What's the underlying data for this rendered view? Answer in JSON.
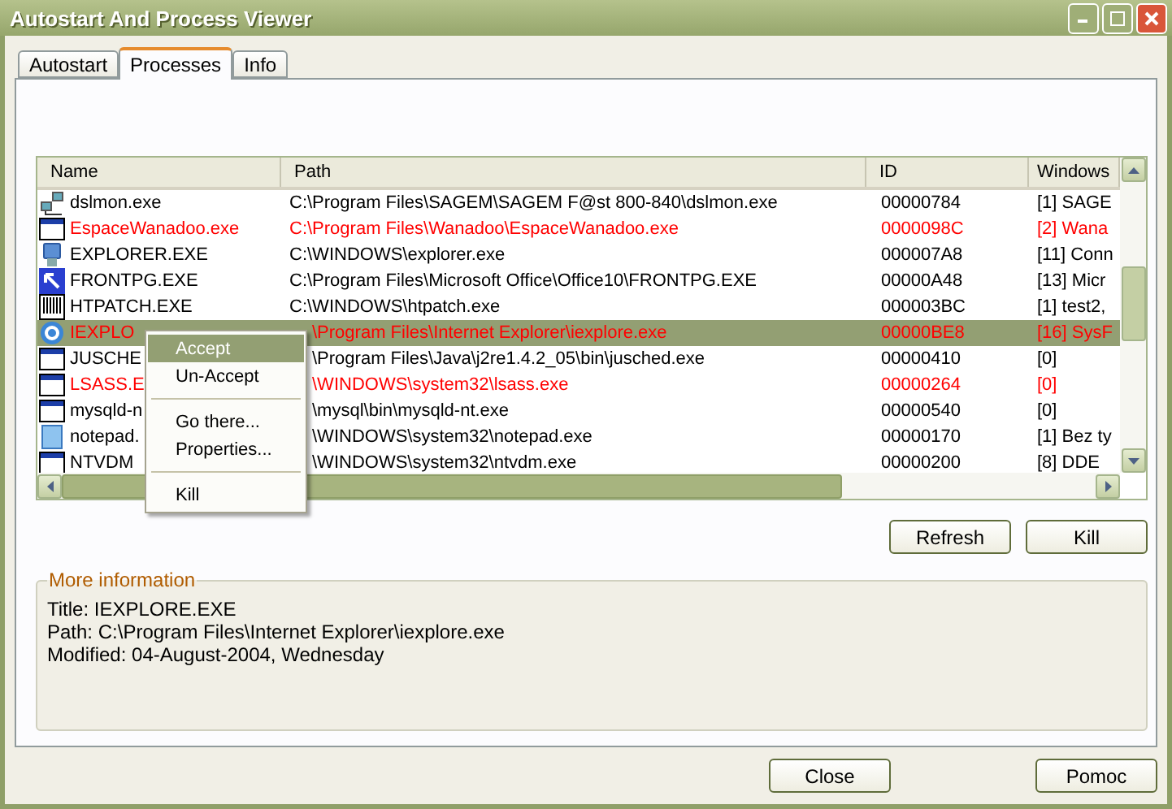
{
  "window": {
    "title": "Autostart And Process Viewer"
  },
  "tabs": [
    {
      "label": "Autostart",
      "selected": false
    },
    {
      "label": "Processes",
      "selected": true
    },
    {
      "label": "Info",
      "selected": false
    }
  ],
  "table": {
    "columns": [
      "Name",
      "Path",
      "ID",
      "Windows"
    ],
    "rows": [
      {
        "kind": "network",
        "name": "dslmon.exe",
        "path": "C:\\Program Files\\SAGEM\\SAGEM F@st 800-840\\dslmon.exe",
        "id": "00000784",
        "windows": "[1] SAGE",
        "accepted": true,
        "selected": false
      },
      {
        "kind": "window",
        "name": "EspaceWanadoo.exe",
        "path": "C:\\Program Files\\Wanadoo\\EspaceWanadoo.exe",
        "id": "0000098C",
        "windows": "[2] Wana",
        "accepted": false,
        "selected": false
      },
      {
        "kind": "computer",
        "name": "EXPLORER.EXE",
        "path": "C:\\WINDOWS\\explorer.exe",
        "id": "000007A8",
        "windows": "[11] Conn",
        "accepted": true,
        "selected": false
      },
      {
        "kind": "shortcut",
        "name": "FRONTPG.EXE",
        "path": "C:\\Program Files\\Microsoft Office\\Office10\\FRONTPG.EXE",
        "id": "00000A48",
        "windows": "[13] Micr",
        "accepted": true,
        "selected": false
      },
      {
        "kind": "barcode",
        "name": "HTPATCH.EXE",
        "path": "C:\\WINDOWS\\htpatch.exe",
        "id": "000003BC",
        "windows": "[1] test2,",
        "accepted": true,
        "selected": false
      },
      {
        "kind": "globe",
        "name": "IEXPLO",
        "path": "\\Program Files\\Internet Explorer\\iexplore.exe",
        "id": "00000BE8",
        "windows": "[16] SysF",
        "accepted": false,
        "selected": true
      },
      {
        "kind": "window",
        "name": "JUSCHE",
        "path": "\\Program Files\\Java\\j2re1.4.2_05\\bin\\jusched.exe",
        "id": "00000410",
        "windows": "[0]",
        "accepted": true,
        "selected": false
      },
      {
        "kind": "window",
        "name": "LSASS.E",
        "path": "\\WINDOWS\\system32\\lsass.exe",
        "id": "00000264",
        "windows": "[0]",
        "accepted": false,
        "selected": false
      },
      {
        "kind": "window",
        "name": "mysqld-n",
        "path": "\\mysql\\bin\\mysqld-nt.exe",
        "id": "00000540",
        "windows": "[0]",
        "accepted": true,
        "selected": false
      },
      {
        "kind": "notepad",
        "name": "notepad.",
        "path": "\\WINDOWS\\system32\\notepad.exe",
        "id": "00000170",
        "windows": "[1] Bez ty",
        "accepted": true,
        "selected": false
      },
      {
        "kind": "window",
        "name": "NTVDM",
        "path": "\\WINDOWS\\system32\\ntvdm.exe",
        "id": "00000200",
        "windows": "[8] DDE",
        "accepted": true,
        "selected": false
      }
    ]
  },
  "context_menu": {
    "items": [
      {
        "kind": "item",
        "label": "Accept",
        "selected": true
      },
      {
        "kind": "item",
        "label": "Un-Accept",
        "selected": false
      },
      {
        "kind": "separator"
      },
      {
        "kind": "item",
        "label": "Go there...",
        "selected": false
      },
      {
        "kind": "item",
        "label": "Properties...",
        "selected": false
      },
      {
        "kind": "separator"
      },
      {
        "kind": "item",
        "label": "Kill",
        "selected": false
      }
    ]
  },
  "list_buttons": [
    "Refresh",
    "Kill"
  ],
  "more_information": {
    "legend": "More information",
    "lines": [
      "Title: IEXPLORE.EXE",
      "Path: C:\\Program Files\\Internet Explorer\\iexplore.exe",
      "Modified: 04-August-2004, Wednesday"
    ]
  },
  "dialog_buttons": [
    "Close",
    "Pomoc"
  ]
}
